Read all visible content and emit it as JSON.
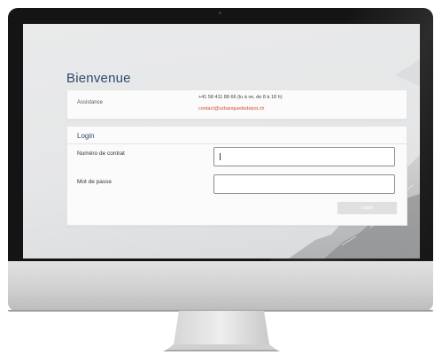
{
  "page": {
    "title": "Bienvenue"
  },
  "assistance": {
    "label": "Assistance",
    "phone": "+41 58 411 88 66 (lu à ve, de 8 à 18 h)",
    "email": "contact@vzbanquededepot.ch"
  },
  "login": {
    "title": "Login",
    "contract_label": "Numéro de contrat",
    "contract_value": "",
    "password_label": "Mot de passe",
    "password_value": "",
    "button_label": "Login"
  },
  "colors": {
    "title_blue": "#2c4a6e",
    "link_orange": "#d2502e",
    "button_disabled": "#e0e0e0"
  }
}
